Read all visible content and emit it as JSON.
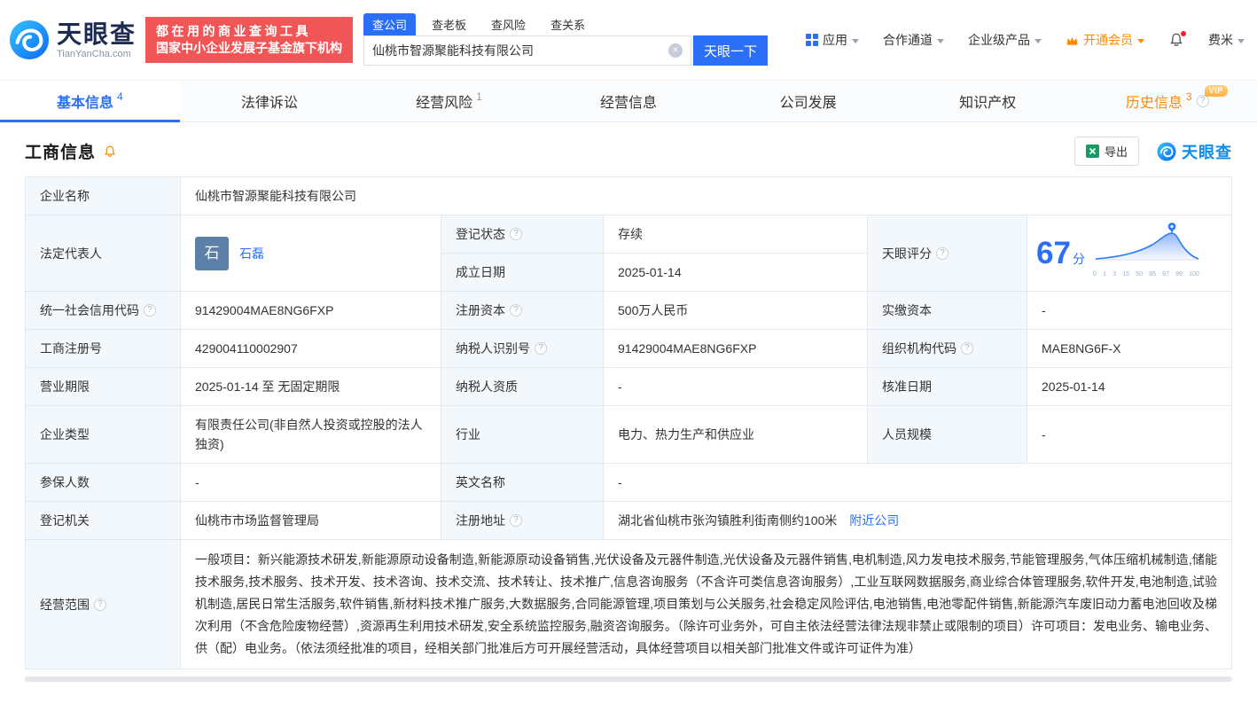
{
  "colors": {
    "accent": "#2a6ff6",
    "brand": "#0b8cf0",
    "green": "#00a854",
    "orange": "#ff8a00",
    "red": "#f25555",
    "label_bg": "#f2f8fc",
    "border": "#e3e9f1"
  },
  "icons": {
    "help": "?",
    "clear": "×"
  },
  "header": {
    "logo": {
      "name": "天眼查",
      "domain": "TianYanCha.com"
    },
    "slogan": {
      "line1": "都在用的商业查询工具",
      "line2": "国家中小企业发展子基金旗下机构"
    },
    "search": {
      "tabs": [
        {
          "label": "查公司"
        },
        {
          "label": "查老板"
        },
        {
          "label": "查风险"
        },
        {
          "label": "查关系"
        }
      ],
      "value": "仙桃市智源聚能科技有限公司",
      "button": "天眼一下"
    },
    "nav": {
      "apps": "应用",
      "partners": "合作通道",
      "enterprise": "企业级产品",
      "vip": "开通会员",
      "user": "费米"
    }
  },
  "tabs": {
    "basic": {
      "label": "基本信息",
      "count": "4"
    },
    "legal": {
      "label": "法律诉讼"
    },
    "risk": {
      "label": "经营风险",
      "count": "1"
    },
    "operation": {
      "label": "经营信息"
    },
    "development": {
      "label": "公司发展"
    },
    "ip": {
      "label": "知识产权"
    },
    "history": {
      "label": "历史信息",
      "count": "3",
      "vip_badge": "VIP"
    }
  },
  "section": {
    "title": "工商信息",
    "export": "导出",
    "logo": "天眼查"
  },
  "business": {
    "company_name": {
      "label": "企业名称",
      "value": "仙桃市智源聚能科技有限公司"
    },
    "legal_rep": {
      "label": "法定代表人",
      "avatar": "石",
      "name": "石磊"
    },
    "reg_status": {
      "label": "登记状态",
      "value": "存续"
    },
    "establish_date": {
      "label": "成立日期",
      "value": "2025-01-14"
    },
    "score": {
      "label": "天眼评分",
      "value": "67",
      "unit": "分",
      "ticks": [
        "0",
        "1",
        "3",
        "15",
        "50",
        "85",
        "97",
        "99",
        "100"
      ]
    },
    "credit_code": {
      "label": "统一社会信用代码",
      "value": "91429004MAE8NG6FXP"
    },
    "reg_capital": {
      "label": "注册资本",
      "value": "500万人民币"
    },
    "paid_capital": {
      "label": "实缴资本",
      "value": "-"
    },
    "reg_number": {
      "label": "工商注册号",
      "value": "429004110002907"
    },
    "taxpayer_id": {
      "label": "纳税人识别号",
      "value": "91429004MAE8NG6FXP"
    },
    "org_code": {
      "label": "组织机构代码",
      "value": "MAE8NG6F-X"
    },
    "business_term": {
      "label": "营业期限",
      "value": "2025-01-14 至 无固定期限"
    },
    "taxpayer_quality": {
      "label": "纳税人资质",
      "value": "-"
    },
    "approval_date": {
      "label": "核准日期",
      "value": "2025-01-14"
    },
    "company_type": {
      "label": "企业类型",
      "value": "有限责任公司(非自然人投资或控股的法人独资)"
    },
    "industry": {
      "label": "行业",
      "value": "电力、热力生产和供应业"
    },
    "staff_size": {
      "label": "人员规模",
      "value": "-"
    },
    "insured_count": {
      "label": "参保人数",
      "value": "-"
    },
    "english_name": {
      "label": "英文名称",
      "value": "-"
    },
    "reg_authority": {
      "label": "登记机关",
      "value": "仙桃市市场监督管理局"
    },
    "reg_address": {
      "label": "注册地址",
      "value": "湖北省仙桃市张沟镇胜利街南侧约100米",
      "nearby": "附近公司"
    },
    "business_scope": {
      "label": "经营范围",
      "value": "一般项目：新兴能源技术研发,新能源原动设备制造,新能源原动设备销售,光伏设备及元器件制造,光伏设备及元器件销售,电机制造,风力发电技术服务,节能管理服务,气体压缩机械制造,储能技术服务,技术服务、技术开发、技术咨询、技术交流、技术转让、技术推广,信息咨询服务（不含许可类信息咨询服务）,工业互联网数据服务,商业综合体管理服务,软件开发,电池制造,试验机制造,居民日常生活服务,软件销售,新材料技术推广服务,大数据服务,合同能源管理,项目策划与公关服务,社会稳定风险评估,电池销售,电池零配件销售,新能源汽车废旧动力蓄电池回收及梯次利用（不含危险废物经营）,资源再生利用技术研发,安全系统监控服务,融资咨询服务。（除许可业务外，可自主依法经营法律法规非禁止或限制的项目）许可项目：发电业务、输电业务、供（配）电业务。（依法须经批准的项目，经相关部门批准后方可开展经营活动，具体经营项目以相关部门批准文件或许可证件为准）"
    }
  }
}
